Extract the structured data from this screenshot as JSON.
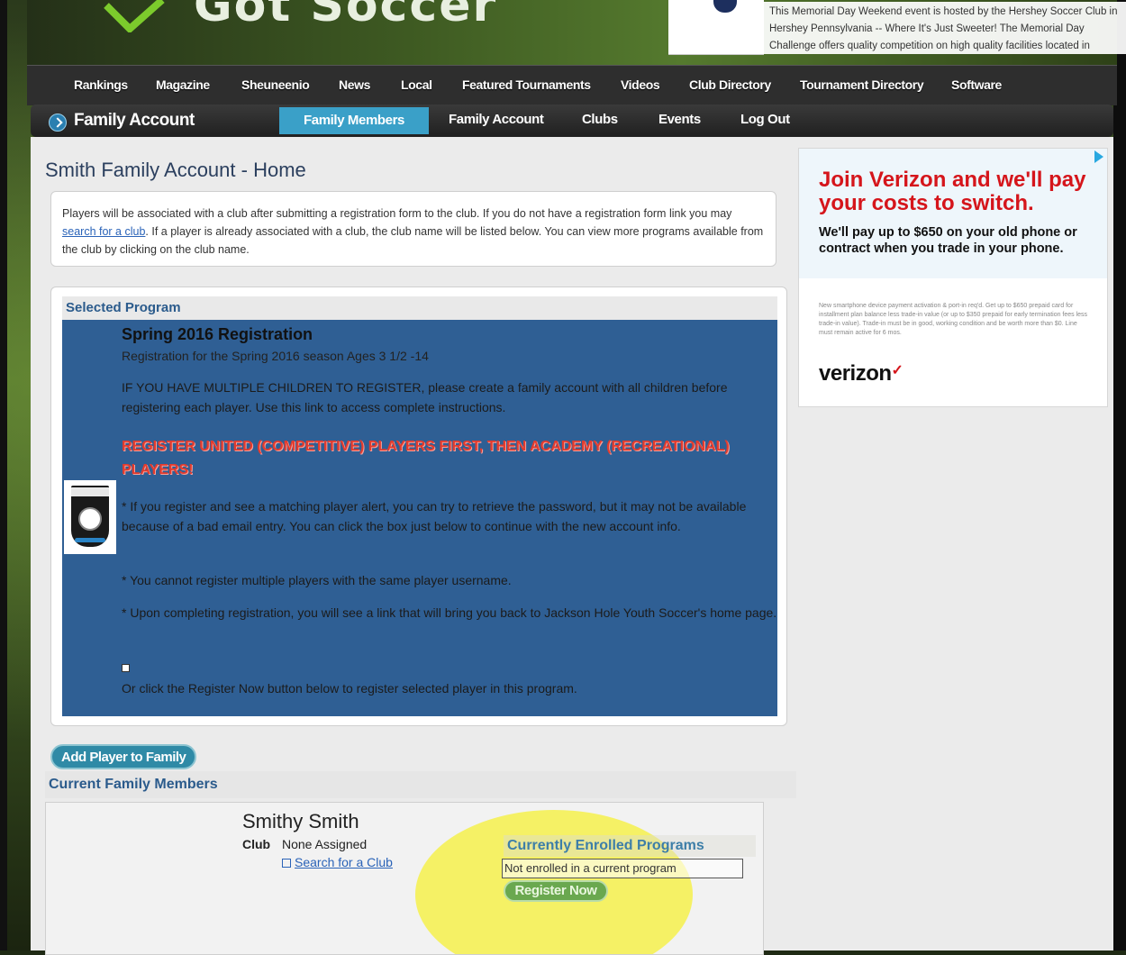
{
  "banner": {
    "logo_text": "Got Soccer",
    "promo_text": "This Memorial Day Weekend event is hosted by the Hershey Soccer Club in Hershey Pennsylvania -- Where It's Just Sweeter! The Memorial Day Challenge offers quality competition on high quality facilities located in"
  },
  "main_nav": {
    "items": [
      "Rankings",
      "Magazine",
      "Sheuneenio",
      "News",
      "Local",
      "Featured Tournaments",
      "Videos",
      "Club Directory",
      "Tournament Directory",
      "Software"
    ]
  },
  "sub_nav": {
    "title": "Family Account",
    "tabs": [
      "Family Members",
      "Family Account",
      "Clubs",
      "Events",
      "Log Out"
    ],
    "active_tab": "Family Members"
  },
  "page": {
    "title": "Smith Family Account - Home",
    "info_pre": "Players will be associated with a club after submitting a registration form to the club. If you do not have a registration form link you may ",
    "info_link": "search for a club",
    "info_post": ". If a player is already associated with a club, the club name will be listed below. You can view more programs available from the club by clicking on the club name."
  },
  "program": {
    "header": "Selected Program",
    "title": "Spring 2016 Registration",
    "subtitle": "Registration for the Spring 2016 season Ages 3 1/2 -14",
    "para1": "IF YOU HAVE MULTIPLE CHILDREN TO REGISTER, please create a family account with all children before registering each player. Use this link to access complete instructions.",
    "red_notice": "REGISTER UNITED (COMPETITIVE) PLAYERS FIRST, THEN ACADEMY (RECREATIONAL) PLAYERS!",
    "bullet1": "* If you register and see a matching player alert, you can try to retrieve the password, but it may not be available because of a bad email entry. You can click the box just below to continue with the new account info.",
    "bullet2": "* You cannot register multiple players with the same player username.",
    "bullet3": "* Upon completing registration, you will see a link that will bring you back to Jackson Hole Youth Soccer's home page.",
    "footer": "Or click the Register Now button below to register selected player in this program."
  },
  "family": {
    "add_button": "Add Player to Family",
    "header": "Current Family Members",
    "member_name": "Smithy Smith",
    "club_label": "Club",
    "club_value": "None Assigned",
    "search_club": "Search for a Club",
    "enrolled_header": "Currently Enrolled Programs",
    "enrolled_status": "Not enrolled in a current program",
    "register_button": "Register Now"
  },
  "ad": {
    "headline": "Join Verizon and we'll pay your costs to switch.",
    "subline": "We'll pay up to $650 on your old phone or contract when you trade in your phone.",
    "fine_print": "New smartphone device payment activation & port-in req'd. Get up to $650 prepaid card for installment plan balance less trade-in value (or up to $350 prepaid for early termination fees less trade-in value). Trade-in must be in good, working condition and be worth more than $0. Line must remain active for 6 mos.",
    "brand": "verizon",
    "brand_mark": "✓"
  },
  "colors": {
    "program_bg": "#2f5f94",
    "active_tab": "#3aa0c8",
    "notice_red": "#e23b2e",
    "register_green": "#6aa84f",
    "verizon_red": "#d5151b"
  }
}
